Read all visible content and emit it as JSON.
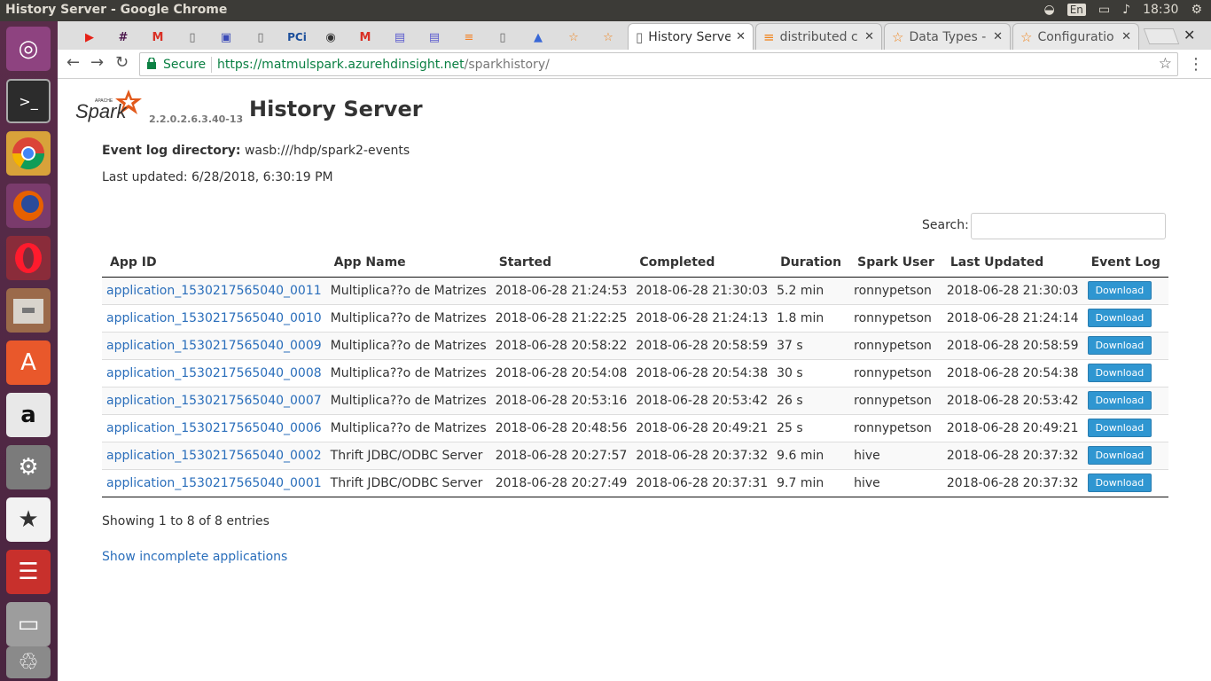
{
  "window": {
    "title": "History Server - Google Chrome",
    "keyboard": "En",
    "time": "18:30"
  },
  "launcher": {
    "icons": [
      "ubuntu-icon",
      "terminal-icon",
      "chrome-icon",
      "firefox-icon",
      "opera-icon",
      "files-icon",
      "software-center-icon",
      "amazon-icon",
      "system-settings-icon",
      "wizard-icon",
      "pdf-reader-icon",
      "drive-icon",
      "trash-icon"
    ]
  },
  "tabs": {
    "pinned": [
      "youtube-icon",
      "slack-icon",
      "gmail-icon",
      "document-icon",
      "contacts-icon",
      "document-icon",
      "pci-icon",
      "camera-icon",
      "gmail-icon",
      "chat-icon",
      "chat-icon",
      "stackoverflow-icon",
      "document-icon",
      "azure-icon",
      "spark-star-icon",
      "spark-star-icon"
    ],
    "pinned_text": {
      "pci": "PCi"
    },
    "full": [
      {
        "label": "History Serve",
        "active": true
      },
      {
        "label": "distributed c",
        "active": false
      },
      {
        "label": "Data Types -",
        "active": false
      },
      {
        "label": "Configuratio",
        "active": false
      }
    ]
  },
  "omnibox": {
    "secure": "Secure",
    "url_host": "https://matmulspark.azurehdinsight.net",
    "url_path": "/sparkhistory/"
  },
  "page": {
    "logo_word": "Spark",
    "logo_small": "APACHE",
    "version": "2.2.0.2.6.3.40-13",
    "title": "History Server",
    "event_log_label": "Event log directory:",
    "event_log_value": "wasb:///hdp/spark2-events",
    "last_updated": "Last updated: 6/28/2018, 6:30:19 PM",
    "search_label": "Search:",
    "columns": [
      "App ID",
      "App Name",
      "Started",
      "Completed",
      "Duration",
      "Spark User",
      "Last Updated",
      "Event Log"
    ],
    "rows": [
      {
        "id": "application_1530217565040_0011",
        "name": "Multiplica??o de Matrizes",
        "started": "2018-06-28 21:24:53",
        "completed": "2018-06-28 21:30:03",
        "duration": "5.2 min",
        "user": "ronnypetson",
        "updated": "2018-06-28 21:30:03",
        "log": "Download"
      },
      {
        "id": "application_1530217565040_0010",
        "name": "Multiplica??o de Matrizes",
        "started": "2018-06-28 21:22:25",
        "completed": "2018-06-28 21:24:13",
        "duration": "1.8 min",
        "user": "ronnypetson",
        "updated": "2018-06-28 21:24:14",
        "log": "Download"
      },
      {
        "id": "application_1530217565040_0009",
        "name": "Multiplica??o de Matrizes",
        "started": "2018-06-28 20:58:22",
        "completed": "2018-06-28 20:58:59",
        "duration": "37 s",
        "user": "ronnypetson",
        "updated": "2018-06-28 20:58:59",
        "log": "Download"
      },
      {
        "id": "application_1530217565040_0008",
        "name": "Multiplica??o de Matrizes",
        "started": "2018-06-28 20:54:08",
        "completed": "2018-06-28 20:54:38",
        "duration": "30 s",
        "user": "ronnypetson",
        "updated": "2018-06-28 20:54:38",
        "log": "Download"
      },
      {
        "id": "application_1530217565040_0007",
        "name": "Multiplica??o de Matrizes",
        "started": "2018-06-28 20:53:16",
        "completed": "2018-06-28 20:53:42",
        "duration": "26 s",
        "user": "ronnypetson",
        "updated": "2018-06-28 20:53:42",
        "log": "Download"
      },
      {
        "id": "application_1530217565040_0006",
        "name": "Multiplica??o de Matrizes",
        "started": "2018-06-28 20:48:56",
        "completed": "2018-06-28 20:49:21",
        "duration": "25 s",
        "user": "ronnypetson",
        "updated": "2018-06-28 20:49:21",
        "log": "Download"
      },
      {
        "id": "application_1530217565040_0002",
        "name": "Thrift JDBC/ODBC Server",
        "started": "2018-06-28 20:27:57",
        "completed": "2018-06-28 20:37:32",
        "duration": "9.6 min",
        "user": "hive",
        "updated": "2018-06-28 20:37:32",
        "log": "Download"
      },
      {
        "id": "application_1530217565040_0001",
        "name": "Thrift JDBC/ODBC Server",
        "started": "2018-06-28 20:27:49",
        "completed": "2018-06-28 20:37:31",
        "duration": "9.7 min",
        "user": "hive",
        "updated": "2018-06-28 20:37:32",
        "log": "Download"
      }
    ],
    "showing": "Showing 1 to 8 of 8 entries",
    "incomplete_link": "Show incomplete applications"
  }
}
